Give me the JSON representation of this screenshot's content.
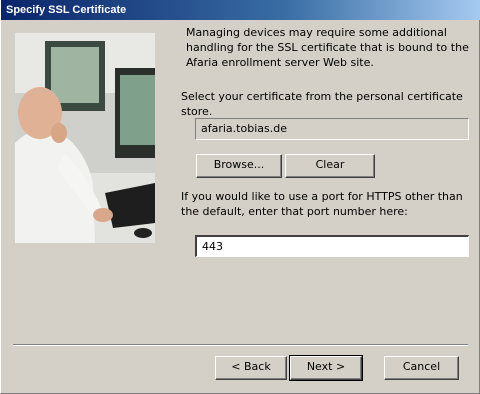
{
  "window": {
    "title": "Specify SSL Certificate"
  },
  "content": {
    "intro": "Managing devices may require some additional handling for the SSL certificate that is bound to the Afaria enrollment server Web site.",
    "select_label": "Select your certificate from the personal certificate store.",
    "certificate_value": "afaria.tobias.de",
    "browse_label": "Browse...",
    "clear_label": "Clear",
    "port_label": "If you would like to use a port for HTTPS other than the default, enter that port number here:",
    "port_value": "443"
  },
  "footer": {
    "back_label": "< Back",
    "next_label": "Next >",
    "cancel_label": "Cancel"
  }
}
